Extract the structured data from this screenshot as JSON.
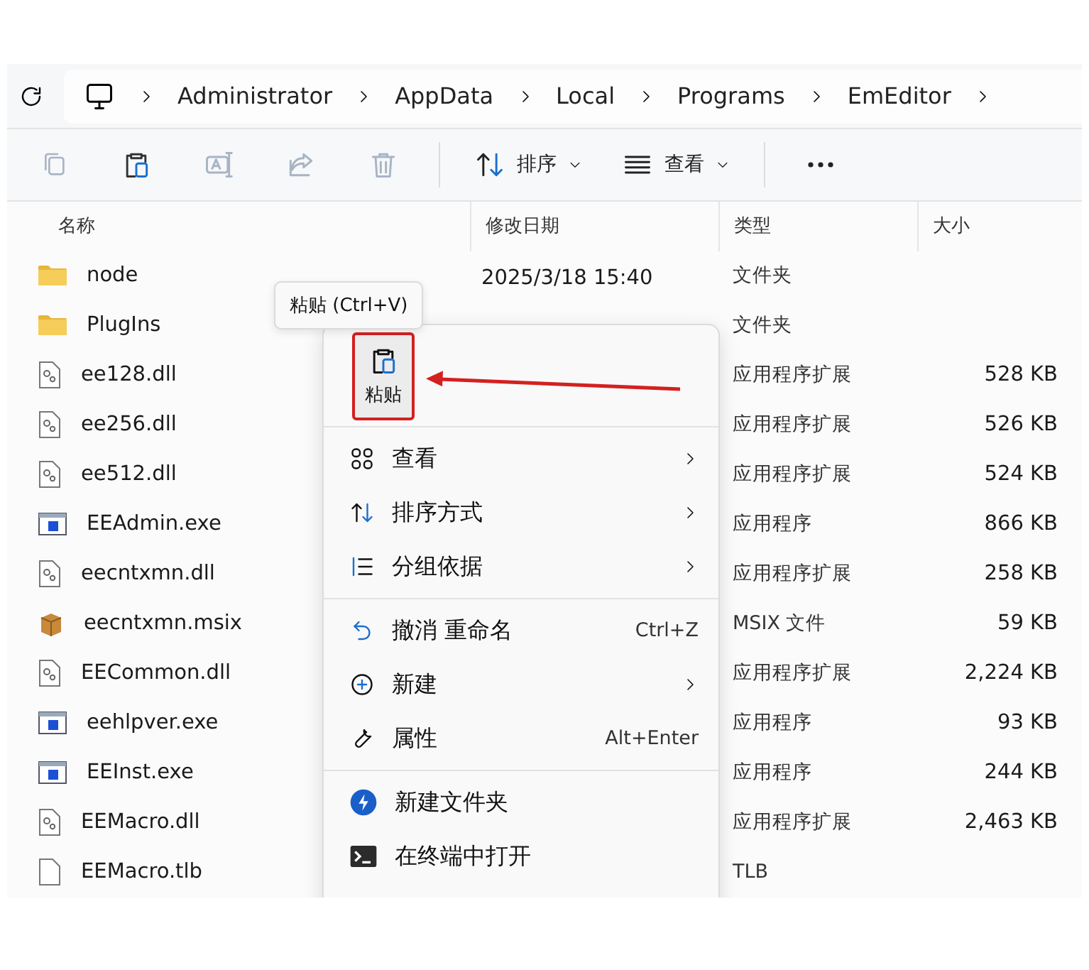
{
  "breadcrumb": [
    "Administrator",
    "AppData",
    "Local",
    "Programs",
    "EmEditor"
  ],
  "toolbar": {
    "actions": [
      {
        "disabled": true
      },
      {
        "disabled": false
      },
      {
        "disabled": true
      },
      {
        "disabled": true
      },
      {
        "disabled": true
      }
    ],
    "menus": [
      {
        "label": "排序"
      },
      {
        "label": "查看"
      }
    ]
  },
  "columns": [
    "名称",
    "修改日期",
    "类型",
    "大小"
  ],
  "files": [
    {
      "kind": "folder",
      "name": "node",
      "date": "2025/3/18 15:40",
      "type": "文件夹"
    },
    {
      "kind": "folder",
      "name": "PlugIns",
      "type": "文件夹"
    },
    {
      "kind": "dll",
      "name": "ee128.dll",
      "type": "应用程序扩展",
      "size": "528 KB"
    },
    {
      "kind": "dll",
      "name": "ee256.dll",
      "type": "应用程序扩展",
      "size": "526 KB"
    },
    {
      "kind": "dll",
      "name": "ee512.dll",
      "type": "应用程序扩展",
      "size": "524 KB"
    },
    {
      "kind": "exe",
      "name": "EEAdmin.exe",
      "type": "应用程序",
      "size": "866 KB"
    },
    {
      "kind": "dll",
      "name": "eecntxmn.dll",
      "type": "应用程序扩展",
      "size": "258 KB"
    },
    {
      "kind": "msix",
      "name": "eecntxmn.msix",
      "type": "MSIX 文件",
      "size": "59 KB"
    },
    {
      "kind": "dll",
      "name": "EECommon.dll",
      "type": "应用程序扩展",
      "size": "2,224 KB"
    },
    {
      "kind": "exe",
      "name": "eehlpver.exe",
      "type": "应用程序",
      "size": "93 KB"
    },
    {
      "kind": "exe",
      "name": "EEInst.exe",
      "type": "应用程序",
      "size": "244 KB"
    },
    {
      "kind": "dll",
      "name": "EEMacro.dll",
      "type": "应用程序扩展",
      "size": "2,463 KB"
    },
    {
      "kind": "file",
      "name": "EEMacro.tlb",
      "type": "TLB"
    }
  ],
  "tooltip": "粘贴 (Ctrl+V)",
  "context_menu": {
    "quick_action": {
      "label": "粘贴",
      "highlighted": true
    },
    "sections": [
      [
        {
          "label": "查看",
          "submenu": true
        },
        {
          "label": "排序方式",
          "submenu": true
        },
        {
          "label": "分组依据",
          "submenu": true
        }
      ],
      [
        {
          "label": "撤消 重命名",
          "shortcut": "Ctrl+Z",
          "submenu": false
        },
        {
          "label": "新建",
          "submenu": true
        },
        {
          "label": "属性",
          "shortcut": "Alt+Enter",
          "submenu": false
        }
      ],
      [
        {
          "label": "新建文件夹",
          "submenu": false
        },
        {
          "label": "在终端中打开",
          "submenu": false
        }
      ]
    ]
  }
}
